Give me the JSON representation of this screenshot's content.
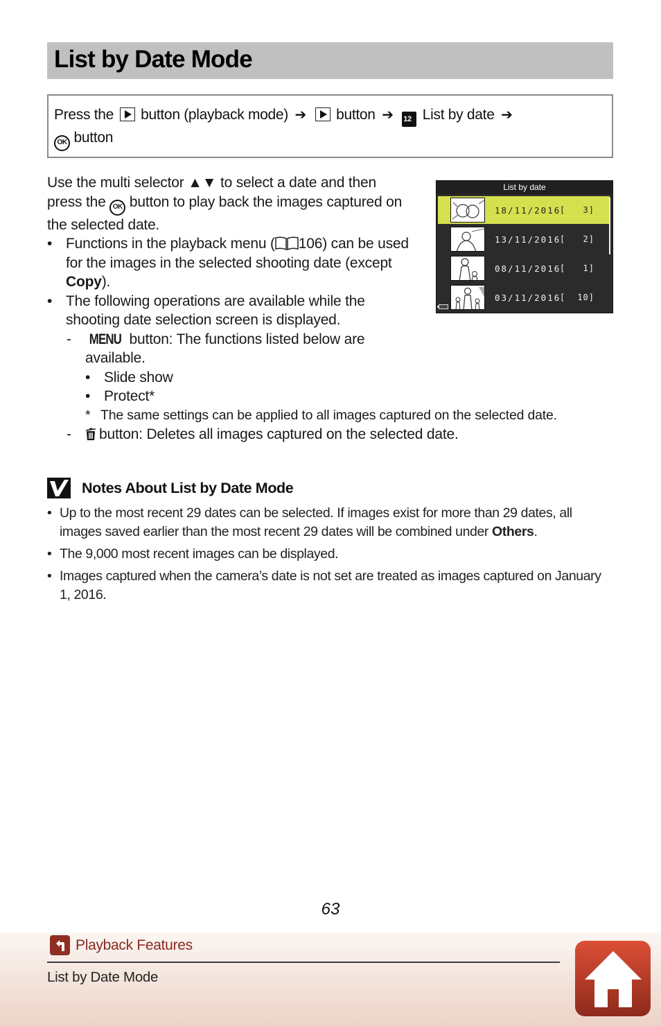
{
  "header": {
    "title": "List by Date Mode"
  },
  "path_box": {
    "press_the": "Press the",
    "step1": "button (playback mode)",
    "step2": "button",
    "step3": "List by date",
    "step4": "button",
    "icons": [
      "playback-icon",
      "arrow-right-icon",
      "playback-icon",
      "arrow-right-icon",
      "list-by-date-icon",
      "arrow-right-icon",
      "ok-icon"
    ],
    "cal_icon_text": "12",
    "ok_text": "OK"
  },
  "body": {
    "intro_part1": "Use the multi selector",
    "intro_arrows": "▲▼",
    "intro_part2": "to select a date and then press the",
    "intro_part3": "button to play back the images captured on the selected date.",
    "bullet1_part1": "Functions in the playback menu (",
    "bullet1_ref": "106",
    "bullet1_part2": ") can be used for the images in the selected shooting date (except",
    "bullet1_bold": "Copy",
    "bullet1_part3": ").",
    "bullet2": "The following operations are available while the shooting date selection screen is displayed.",
    "dash_mark": "-",
    "menu_label": "MENU",
    "menu_text": "button: The functions listed below are available.",
    "menu_items": [
      "Slide show",
      "Protect*"
    ],
    "footnote_star": "*",
    "footnote": "The same settings can be applied to all images captured on the selected date.",
    "delete_text": "button: Deletes all images captured on the selected date."
  },
  "camera_screen": {
    "header": "List by date",
    "selected_index": 0,
    "rows": [
      {
        "date": "18/11/2016",
        "open": "[",
        "count": "3]"
      },
      {
        "date": "13/11/2016",
        "open": "[",
        "count": "2]"
      },
      {
        "date": "08/11/2016",
        "open": "[",
        "count": "1]"
      },
      {
        "date": "03/11/2016",
        "open": "[",
        "count": "10]"
      }
    ],
    "highlight_color": "#d6e04f"
  },
  "notes": {
    "title": "Notes About List by Date Mode",
    "items": [
      {
        "text": "Up to the most recent 29 dates can be selected. If images exist for more than 29 dates, all images saved earlier than the most recent 29 dates will be combined under ",
        "bold": "Others",
        "after": "."
      },
      {
        "text": "The 9,000 most recent images can be displayed.",
        "bold": "",
        "after": ""
      },
      {
        "text": "Images captured when the camera’s date is not set are treated as images captured on January 1, 2016.",
        "bold": "",
        "after": ""
      }
    ]
  },
  "page_number": "63",
  "footer": {
    "back_label": "Playback Features",
    "section": "List by Date Mode",
    "accent_color": "#8f2f22"
  }
}
